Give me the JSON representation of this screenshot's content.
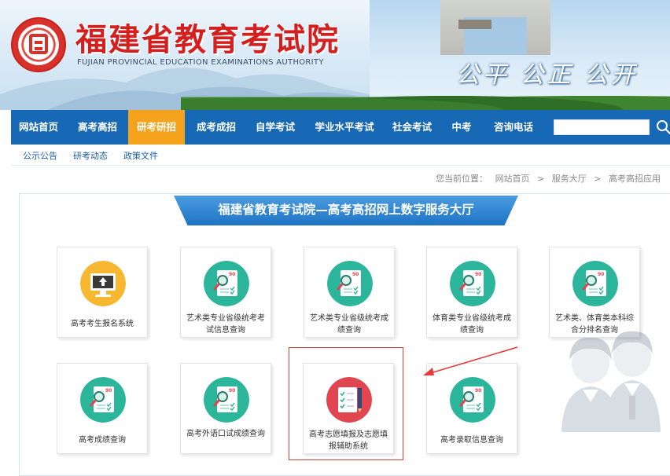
{
  "header": {
    "title": "福建省教育考试院",
    "subtitle": "FUJIAN PROVINCIAL EDUCATION EXAMINATIONS AUTHORITY",
    "slogan": "公平 公正 公开",
    "logo_icon": "seal-logo-icon"
  },
  "nav": {
    "items": [
      {
        "label": "网站首页",
        "active": false
      },
      {
        "label": "高考高招",
        "active": false
      },
      {
        "label": "研考研招",
        "active": true
      },
      {
        "label": "成考成招",
        "active": false
      },
      {
        "label": "自学考试",
        "active": false
      },
      {
        "label": "学业水平考试",
        "active": false
      },
      {
        "label": "社会考试",
        "active": false
      },
      {
        "label": "中考",
        "active": false
      },
      {
        "label": "咨询电话",
        "active": false
      }
    ],
    "search": {
      "value": "",
      "placeholder": ""
    },
    "colors": {
      "bar": "#1769b5",
      "active": "#f5a21c"
    }
  },
  "subnav": {
    "items": [
      "公示公告",
      "研考动态",
      "政策文件"
    ]
  },
  "breadcrumb": {
    "prefix": "您当前位置：",
    "items": [
      "网站首页",
      "服务大厅",
      "高考高招应用"
    ],
    "separator": ">"
  },
  "main": {
    "hall_title": "福建省教育考试院—高考高招网上数字服务大厅",
    "cards": [
      {
        "label": "高考考生报名系统",
        "icon": "monitor-upload-icon",
        "icon_color": "#f7b731"
      },
      {
        "label": "艺术类专业省级统考考试信息查询",
        "icon": "document-search-icon",
        "icon_color": "#2bb59a"
      },
      {
        "label": "艺术类专业省级统考成绩查询",
        "icon": "document-search-icon",
        "icon_color": "#2bb59a"
      },
      {
        "label": "体育类专业省级统考成绩查询",
        "icon": "document-search-icon",
        "icon_color": "#2bb59a"
      },
      {
        "label": "艺术类、体育类本科综合分排名查询",
        "icon": "document-search-icon",
        "icon_color": "#2bb59a"
      },
      {
        "label": "高考成绩查询",
        "icon": "document-search-icon",
        "icon_color": "#2bb59a"
      },
      {
        "label": "高考外语口试成绩查询",
        "icon": "document-search-icon",
        "icon_color": "#2bb59a"
      },
      {
        "label": "高考志愿填报及志愿填报辅助系统",
        "icon": "checklist-pencil-icon",
        "icon_color": "#e04550"
      },
      {
        "label": "高考录取信息查询",
        "icon": "document-search-icon",
        "icon_color": "#2bb59a"
      }
    ],
    "doc_icon_score": "90"
  }
}
